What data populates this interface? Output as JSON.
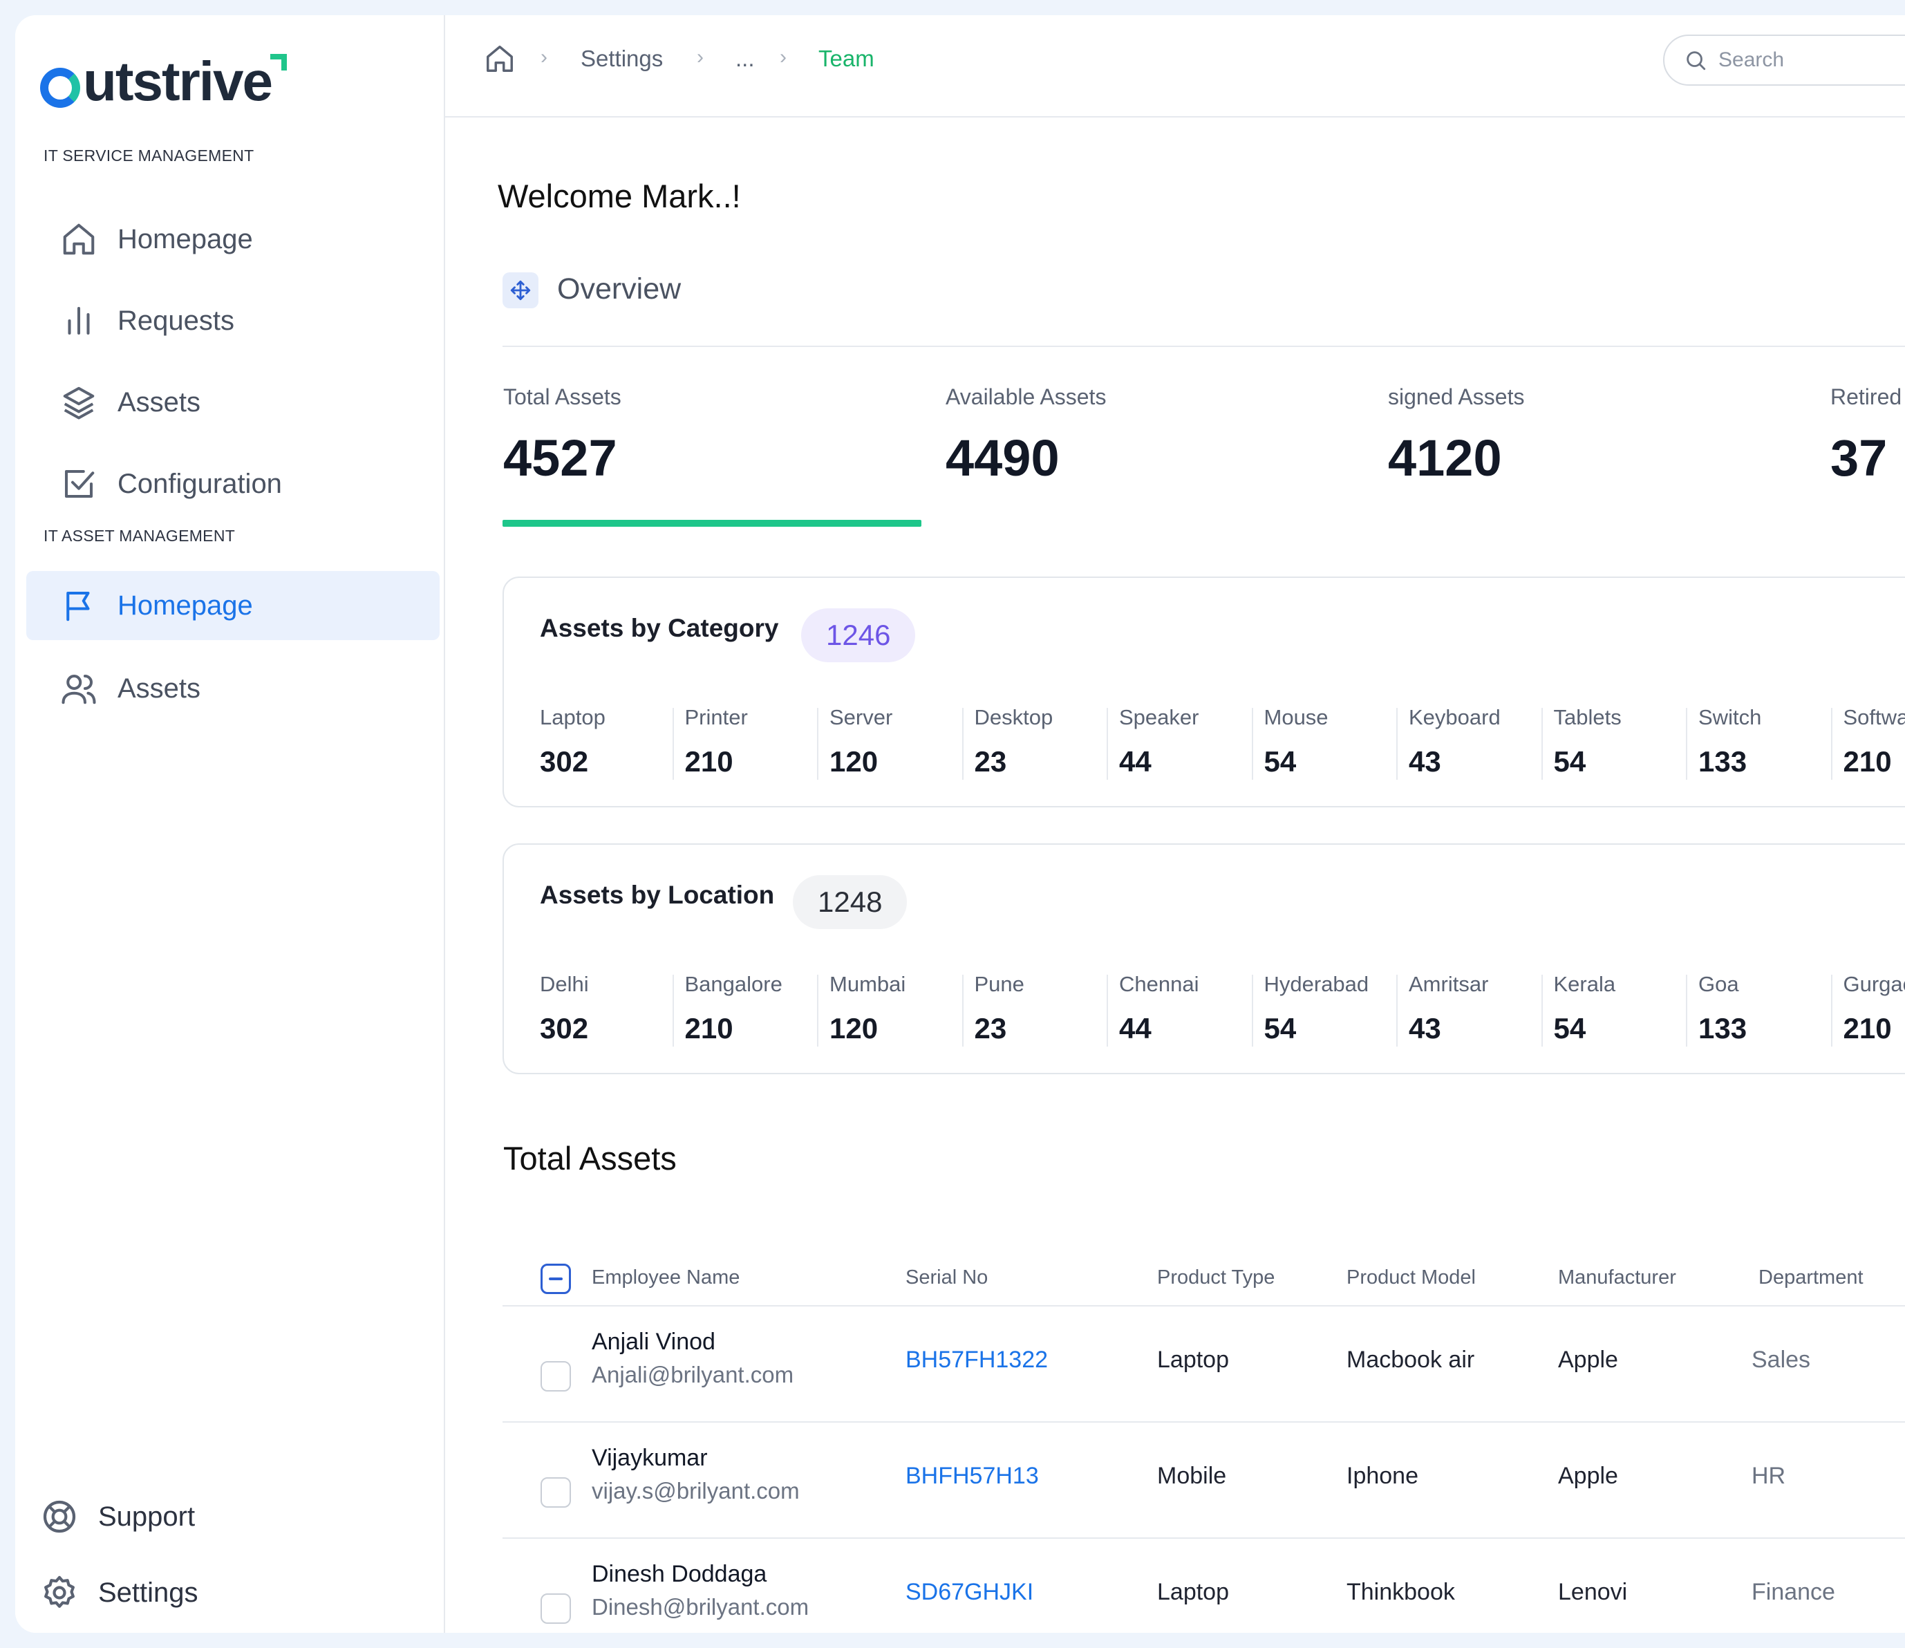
{
  "brand": {
    "name": "utstrive",
    "accent_blue": "#1a73e8",
    "accent_green": "#1ec68a"
  },
  "sidebar": {
    "section1": "IT SERVICE MANAGEMENT",
    "section2": "IT ASSET MANAGEMENT",
    "items": [
      {
        "label": "Homepage",
        "icon": "home-icon"
      },
      {
        "label": "Requests",
        "icon": "bar-chart-icon"
      },
      {
        "label": "Assets",
        "icon": "layers-icon"
      },
      {
        "label": "Configuration",
        "icon": "check-square-icon"
      },
      {
        "label": "Homepage",
        "icon": "flag-icon",
        "active": true
      },
      {
        "label": "Assets",
        "icon": "users-icon"
      }
    ],
    "support": "Support",
    "settings": "Settings"
  },
  "breadcrumb": {
    "items": [
      "Settings",
      "...",
      "Team"
    ]
  },
  "search": {
    "placeholder": "Search"
  },
  "main": {
    "welcome": "Welcome Mark..!",
    "overview": "Overview",
    "stats": [
      {
        "label": "Total Assets",
        "value": "4527"
      },
      {
        "label": "Available Assets",
        "value": "4490"
      },
      {
        "label": "signed Assets",
        "value": "4120"
      },
      {
        "label": "Retired",
        "value": "37"
      }
    ],
    "category": {
      "title": "Assets by Category",
      "count": "1246",
      "cells": [
        {
          "label": "Laptop",
          "value": "302"
        },
        {
          "label": "Printer",
          "value": "210"
        },
        {
          "label": "Server",
          "value": "120"
        },
        {
          "label": "Desktop",
          "value": "23"
        },
        {
          "label": "Speaker",
          "value": "44"
        },
        {
          "label": "Mouse",
          "value": "54"
        },
        {
          "label": "Keyboard",
          "value": "43"
        },
        {
          "label": "Tablets",
          "value": "54"
        },
        {
          "label": "Switch",
          "value": "133"
        },
        {
          "label": "Softwa",
          "value": "210"
        }
      ]
    },
    "location": {
      "title": "Assets by Location",
      "count": "1248",
      "cells": [
        {
          "label": "Delhi",
          "value": "302"
        },
        {
          "label": "Bangalore",
          "value": "210"
        },
        {
          "label": "Mumbai",
          "value": "120"
        },
        {
          "label": "Pune",
          "value": "23"
        },
        {
          "label": "Chennai",
          "value": "44"
        },
        {
          "label": "Hyderabad",
          "value": "54"
        },
        {
          "label": "Amritsar",
          "value": "43"
        },
        {
          "label": "Kerala",
          "value": "54"
        },
        {
          "label": "Goa",
          "value": "133"
        },
        {
          "label": "Gurgao",
          "value": "210"
        }
      ]
    },
    "table": {
      "title": "Total Assets",
      "columns": [
        "Employee Name",
        "Serial No",
        "Product Type",
        "Product Model",
        "Manufacturer",
        "Department"
      ],
      "rows": [
        {
          "name": "Anjali Vinod",
          "email": "Anjali@brilyant.com",
          "serial": "BH57FH1322",
          "type": "Laptop",
          "model": "Macbook air",
          "manufacturer": "Apple",
          "department": "Sales"
        },
        {
          "name": "Vijaykumar",
          "email": "vijay.s@brilyant.com",
          "serial": "BHFH57H13",
          "type": "Mobile",
          "model": "Iphone",
          "manufacturer": "Apple",
          "department": "HR"
        },
        {
          "name": "Dinesh Doddaga",
          "email": "Dinesh@brilyant.com",
          "serial": "SD67GHJKI",
          "type": "Laptop",
          "model": "Thinkbook",
          "manufacturer": "Lenovi",
          "department": "Finance"
        }
      ]
    }
  }
}
